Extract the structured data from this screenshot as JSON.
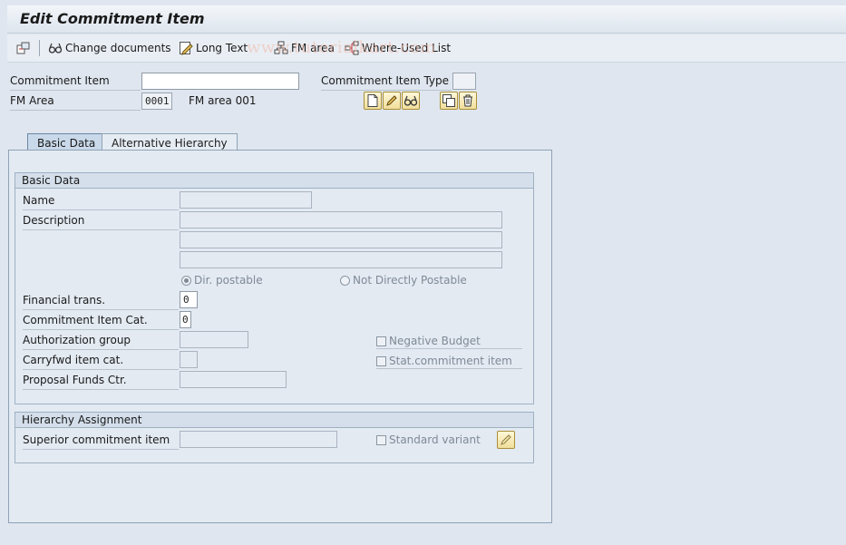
{
  "title": "Edit Commitment Item",
  "toolbar": {
    "change_documents": "Change documents",
    "long_text": "Long Text",
    "fm_area": "FM area",
    "where_used": "Where-Used List"
  },
  "watermark": "www.tutorialkart.com",
  "header": {
    "commitment_item_label": "Commitment Item",
    "commitment_item_value": "",
    "commitment_item_type_label": "Commitment Item Type",
    "commitment_item_type_value": "",
    "fm_area_label": "FM Area",
    "fm_area_value": "0001",
    "fm_area_desc": "FM area 001"
  },
  "tabs": [
    {
      "label": "Basic Data",
      "active": true
    },
    {
      "label": "Alternative Hierarchy",
      "active": false
    }
  ],
  "basic_data": {
    "group_title": "Basic Data",
    "name_label": "Name",
    "name_value": "",
    "description_label": "Description",
    "description_lines": [
      "",
      "",
      ""
    ],
    "radio_dir_postable": "Dir. postable",
    "radio_not_directly": "Not Directly Postable",
    "financial_trans_label": "Financial trans.",
    "financial_trans_value": "0",
    "ci_category_label": "Commitment Item Cat.",
    "ci_category_value": "0",
    "auth_group_label": "Authorization group",
    "auth_group_value": "",
    "carryfwd_label": "Carryfwd item cat.",
    "carryfwd_value": "",
    "proposal_fc_label": "Proposal Funds Ctr.",
    "proposal_fc_value": "",
    "negative_budget_label": "Negative Budget",
    "stat_commitment_label": "Stat.commitment item"
  },
  "hierarchy": {
    "group_title": "Hierarchy Assignment",
    "superior_label": "Superior commitment item",
    "superior_value": "",
    "standard_variant_label": "Standard variant"
  }
}
